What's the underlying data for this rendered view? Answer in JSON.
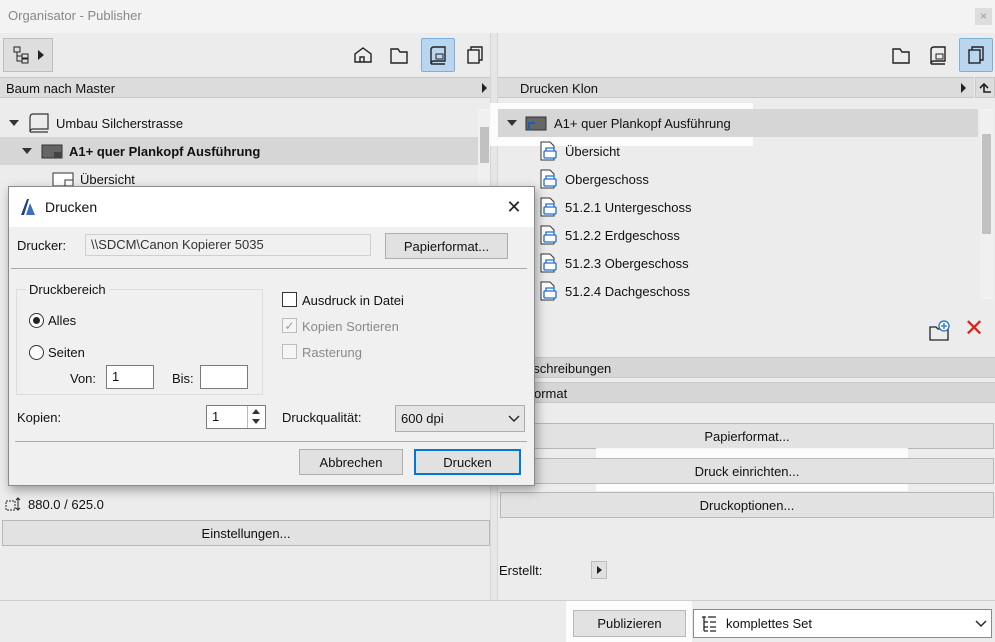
{
  "window": {
    "title": "Organisator - Publisher",
    "close": "×"
  },
  "left": {
    "header": "Baum nach Master",
    "tree": [
      {
        "label": "Umbau Silcherstrasse"
      },
      {
        "label": "A1+ quer Plankopf Ausführung"
      },
      {
        "label": "Übersicht"
      }
    ],
    "size_value": "880.0 / 625.0",
    "settings_button": "Einstellungen..."
  },
  "right": {
    "header": "Drucken Klon",
    "root": "A1+ quer Plankopf Ausführung",
    "items": [
      "Übersicht",
      "Obergeschoss",
      "51.2.1 Untergeschoss",
      "51.2.2 Erdgeschoss",
      "51.2.3 Obergeschoss",
      "51.2.4 Dachgeschoss"
    ],
    "section_desc": "eschreibungen",
    "section_format": "ormat",
    "btn_papierformat": "Papierformat...",
    "btn_druck_einrichten": "Druck einrichten...",
    "btn_druckoptionen": "Druckoptionen...",
    "erstellt_label": "Erstellt:"
  },
  "bottom": {
    "publish_button": "Publizieren",
    "set_select": "komplettes Set"
  },
  "dialog": {
    "title": "Drucken",
    "printer_label": "Drucker:",
    "printer_value": "\\\\SDCM\\Canon Kopierer 5035",
    "paper_button": "Papierformat...",
    "range_group": "Druckbereich",
    "all_label": "Alles",
    "pages_label": "Seiten",
    "from_label": "Von:",
    "from_value": "1",
    "to_label": "Bis:",
    "to_value": "",
    "print_to_file": "Ausdruck in Datei",
    "collate": "Kopien Sortieren",
    "raster": "Rasterung",
    "copies_label": "Kopien:",
    "copies_value": "1",
    "quality_label": "Druckqualität:",
    "quality_value": "600 dpi",
    "cancel_button": "Abbrechen",
    "print_button": "Drucken"
  }
}
